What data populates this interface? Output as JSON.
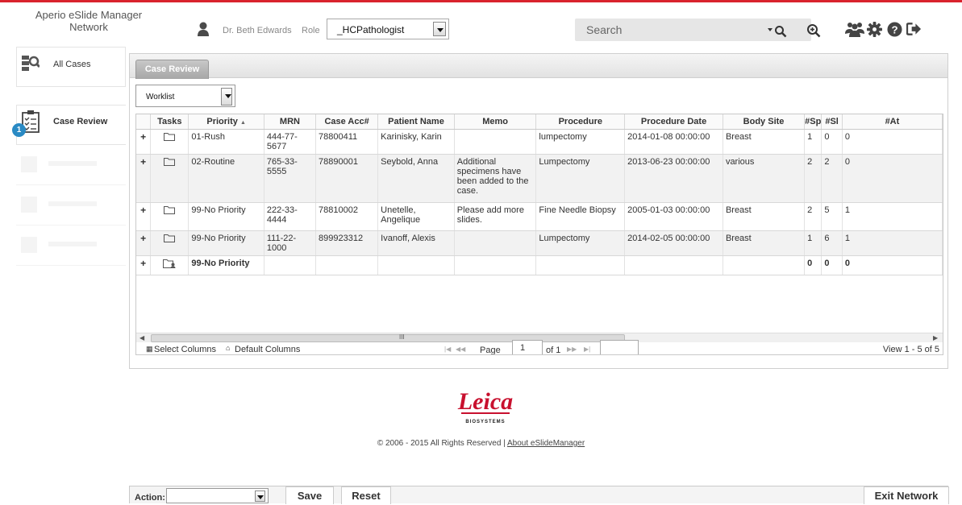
{
  "header": {
    "app_title_line1": "Aperio eSlide Manager",
    "app_title_line2": "Network",
    "user_name": "Dr. Beth Edwards",
    "role_label": "Role",
    "role_value": "_HCPathologist",
    "search_placeholder": "Search",
    "icons": [
      "search-icon",
      "zoom-icon",
      "users-icon",
      "gear-icon",
      "help-icon",
      "logout-icon"
    ]
  },
  "nav": {
    "items": [
      {
        "label": "All Cases",
        "icon": "all-cases-icon"
      },
      {
        "label": "Case Review",
        "icon": "case-review-icon",
        "badge": "1",
        "active": true
      }
    ]
  },
  "panel": {
    "tab_label": "Case Review",
    "worklist_value": "Worklist"
  },
  "grid": {
    "columns": [
      "",
      "Tasks",
      "Priority",
      "MRN",
      "Case Acc#",
      "Patient Name",
      "Memo",
      "Procedure",
      "Procedure Date",
      "Body Site",
      "#Sp",
      "#Sl",
      "#At"
    ],
    "sort_indicator": "▲",
    "rows": [
      {
        "priority": "01-Rush",
        "mrn": "444-77-5677",
        "case_acc": "78800411",
        "patient": "Karinisky, Karin",
        "memo": "",
        "procedure": "lumpectomy",
        "date": "2014-01-08 00:00:00",
        "site": "Breast",
        "sp": "1",
        "sl": "0",
        "at": "0"
      },
      {
        "priority": "02-Routine",
        "mrn": "765-33-5555",
        "case_acc": "78890001",
        "patient": "Seybold, Anna",
        "memo": "Additional specimens have been added to the case.",
        "procedure": "Lumpectomy",
        "date": "2013-06-23 00:00:00",
        "site": "various",
        "sp": "2",
        "sl": "2",
        "at": "0"
      },
      {
        "priority": "99-No Priority",
        "mrn": "222-33-4444",
        "case_acc": "78810002",
        "patient": "Unetelle, Angelique",
        "memo": "Please add more slides.",
        "procedure": "Fine Needle Biopsy",
        "date": "2005-01-03 00:00:00",
        "site": "Breast",
        "sp": "2",
        "sl": "5",
        "at": "1"
      },
      {
        "priority": "99-No Priority",
        "mrn": "111-22-1000",
        "case_acc": "899923312",
        "patient": "Ivanoff, Alexis",
        "memo": "",
        "procedure": "Lumpectomy",
        "date": "2014-02-05 00:00:00",
        "site": "Breast",
        "sp": "1",
        "sl": "6",
        "at": "1"
      },
      {
        "priority": "99-No Priority",
        "mrn": "",
        "case_acc": "",
        "patient": "",
        "memo": "",
        "procedure": "",
        "date": "",
        "site": "",
        "sp": "0",
        "sl": "0",
        "at": "0"
      }
    ],
    "expand_symbol": "+",
    "scroll_grip": "III"
  },
  "pager": {
    "select_columns": "Select Columns",
    "default_columns": "Default Columns",
    "page_label": "Page",
    "page_value": "1",
    "of_label": "of 1",
    "view_text": "View 1 - 5 of 5"
  },
  "footer": {
    "logo_text": "Leica",
    "logo_sub": "BIOSYSTEMS",
    "copyright": "© 2006 - 2015 All Rights Reserved |",
    "about_link": "About eSlideManager"
  },
  "actionbar": {
    "action_label": "Action:",
    "save_label": "Save",
    "reset_label": "Reset",
    "exit_label": "Exit Network"
  },
  "colors": {
    "accent_red": "#d9232d",
    "badge_blue": "#2a8ac4",
    "logo_red": "#c8102e"
  }
}
